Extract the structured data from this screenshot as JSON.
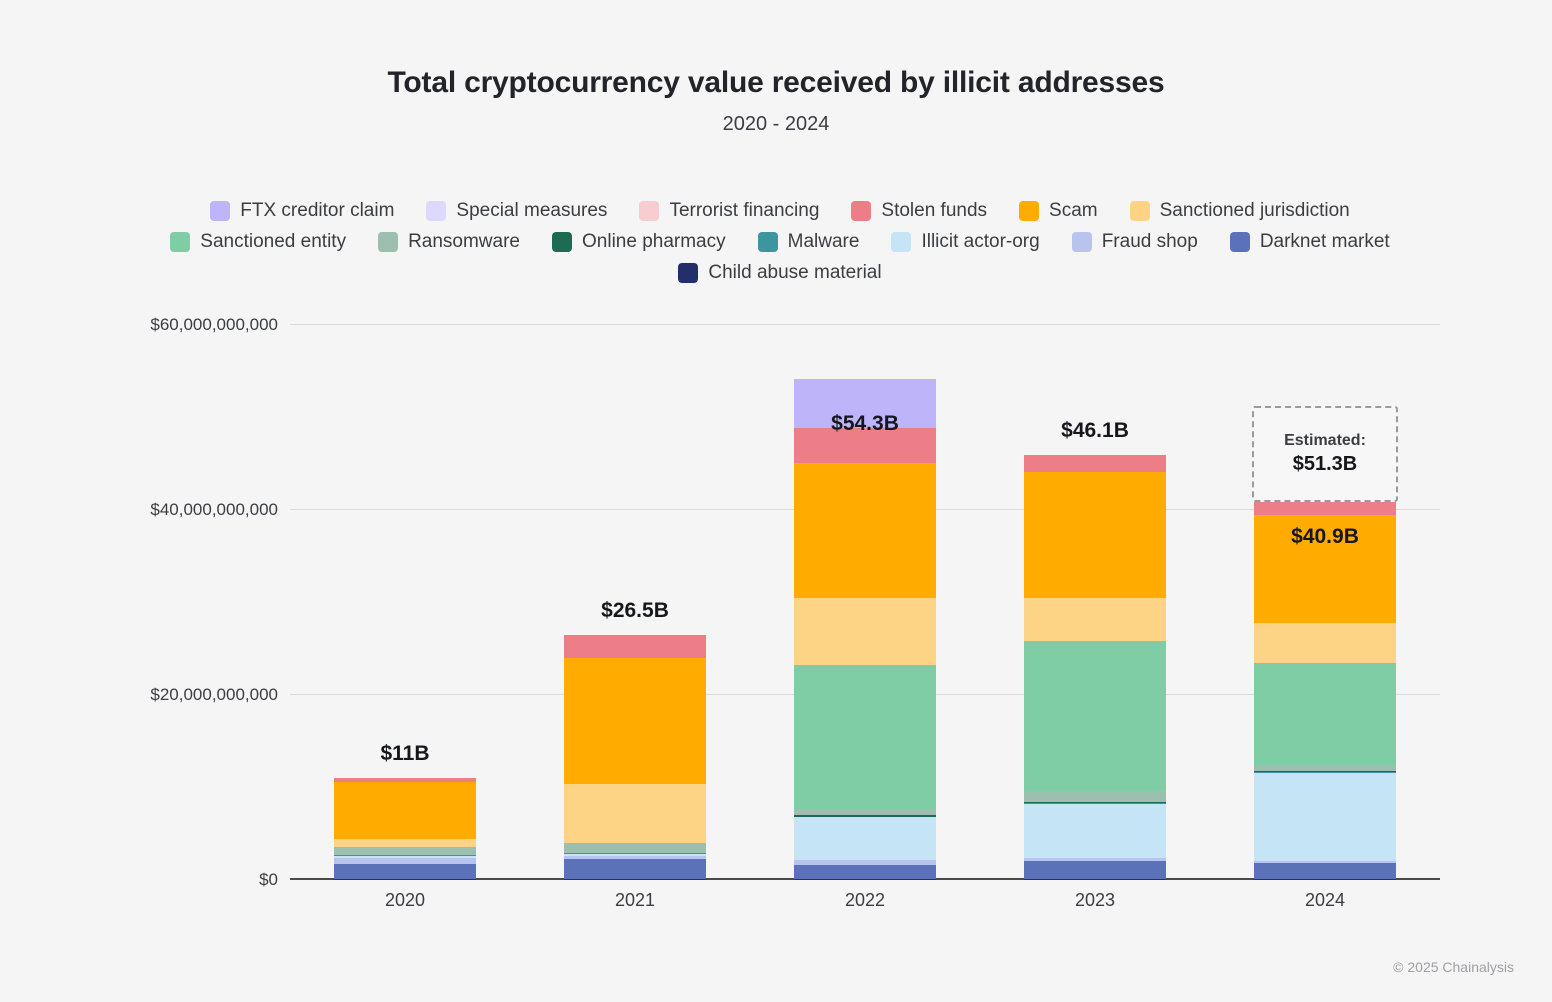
{
  "header": {
    "title": "Total cryptocurrency value received by illicit addresses",
    "subtitle": "2020 - 2024"
  },
  "footer": {
    "credit": "© 2025 Chainalysis"
  },
  "legend": {
    "rows": [
      [
        {
          "label": "FTX creditor claim",
          "color": "#bdb4fa"
        },
        {
          "label": "Special measures",
          "color": "#ddd8fd"
        },
        {
          "label": "Terrorist financing",
          "color": "#f8ccd0"
        },
        {
          "label": "Stolen funds",
          "color": "#ed7e88"
        },
        {
          "label": "Scam",
          "color": "#ffab00"
        },
        {
          "label": "Sanctioned jurisdiction",
          "color": "#fdd385"
        }
      ],
      [
        {
          "label": "Sanctioned entity",
          "color": "#7fcda4"
        },
        {
          "label": "Ransomware",
          "color": "#9cbfb0"
        },
        {
          "label": "Online pharmacy",
          "color": "#1d6b53"
        },
        {
          "label": "Malware",
          "color": "#3d95a0"
        },
        {
          "label": "Illicit actor-org",
          "color": "#c5e5f7"
        },
        {
          "label": "Fraud shop",
          "color": "#b8c4ed"
        },
        {
          "label": "Darknet market",
          "color": "#5b72bb"
        }
      ],
      [
        {
          "label": "Child abuse material",
          "color": "#232f6b"
        }
      ]
    ]
  },
  "chart_data": {
    "type": "bar",
    "stacked": true,
    "title": "Total cryptocurrency value received by illicit addresses",
    "subtitle": "2020 - 2024",
    "xlabel": "",
    "ylabel": "",
    "grid": true,
    "legend_position": "top",
    "ylim": [
      0,
      60000000000
    ],
    "ytick_values": [
      0,
      20000000000,
      40000000000,
      60000000000
    ],
    "ytick_labels": [
      "$0",
      "$20,000,000,000",
      "$40,000,000,000",
      "$60,000,000,000"
    ],
    "categories": [
      "2020",
      "2021",
      "2022",
      "2023",
      "2024"
    ],
    "series": [
      {
        "name": "Child abuse material",
        "color": "#232f6b",
        "values": [
          60000000,
          60000000,
          70000000,
          70000000,
          60000000
        ]
      },
      {
        "name": "Darknet market",
        "color": "#5b72bb",
        "values": [
          1700000000,
          2200000000,
          1500000000,
          2000000000,
          1800000000
        ]
      },
      {
        "name": "Fraud shop",
        "color": "#b8c4ed",
        "values": [
          600000000,
          300000000,
          600000000,
          300000000,
          150000000
        ]
      },
      {
        "name": "Illicit actor-org",
        "color": "#c5e5f7",
        "values": [
          250000000,
          250000000,
          4600000000,
          5900000000,
          9600000000
        ]
      },
      {
        "name": "Malware",
        "color": "#3d95a0",
        "values": [
          60000000,
          60000000,
          60000000,
          60000000,
          60000000
        ]
      },
      {
        "name": "Online pharmacy",
        "color": "#1d6b53",
        "values": [
          90000000,
          90000000,
          200000000,
          150000000,
          100000000
        ]
      },
      {
        "name": "Ransomware",
        "color": "#9cbfb0",
        "values": [
          800000000,
          1000000000,
          550000000,
          1100000000,
          550000000
        ]
      },
      {
        "name": "Sanctioned entity",
        "color": "#7fcda4",
        "values": [
          0,
          0,
          15700000000,
          16300000000,
          11100000000
        ]
      },
      {
        "name": "Sanctioned jurisdiction",
        "color": "#fdd385",
        "values": [
          900000000,
          6400000000,
          7200000000,
          4600000000,
          4400000000
        ]
      },
      {
        "name": "Scam",
        "color": "#ffab00",
        "values": [
          6100000000,
          13700000000,
          14600000000,
          13600000000,
          11700000000
        ]
      },
      {
        "name": "Stolen funds",
        "color": "#ed7e88",
        "values": [
          440000000,
          2400000000,
          3800000000,
          1900000000,
          1400000000
        ]
      },
      {
        "name": "Terrorist financing",
        "color": "#f8ccd0",
        "values": [
          0,
          0,
          0,
          0,
          0
        ]
      },
      {
        "name": "Special measures",
        "color": "#ddd8fd",
        "values": [
          0,
          0,
          0,
          0,
          0
        ]
      },
      {
        "name": "FTX creditor claim",
        "color": "#bdb4fa",
        "values": [
          0,
          0,
          5300000000,
          0,
          0
        ]
      }
    ],
    "bar_totals": [
      {
        "category": "2020",
        "label": "$11B",
        "value": 11000000000
      },
      {
        "category": "2021",
        "label": "$26.5B",
        "value": 26500000000
      },
      {
        "category": "2022",
        "label": "$54.3B",
        "value": 54300000000
      },
      {
        "category": "2023",
        "label": "$46.1B",
        "value": 46100000000
      },
      {
        "category": "2024",
        "label": "$40.9B",
        "value": 40900000000
      }
    ],
    "annotations": [
      {
        "category": "2024",
        "estimate_label": "Estimated:",
        "estimate_value": "$51.3B",
        "value": 51300000000,
        "style": "dashed-box"
      }
    ]
  }
}
